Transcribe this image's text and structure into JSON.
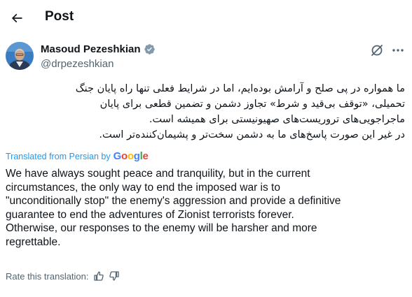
{
  "header": {
    "title": "Post"
  },
  "author": {
    "name": "Masoud Pezeshkian",
    "handle": "@drpezeshkian"
  },
  "post": {
    "original_lines": [
      "ما همواره در پی صلح و آرامش بوده‌ایم، اما در شرایط فعلی تنها راه پایان جنگ",
      "تحمیلی، «توقف بی‌قید و شرط» تجاوز دشمن و تضمین قطعی برای پایان",
      "ماجراجویی‌های تروریست‌های صهیونیستی برای همیشه است.",
      "در غیر این صورت پاسخ‌های ما به دشمن سخت‌تر و پشیمان‌کننده‌تر است."
    ],
    "translated_from": "Translated from Persian by",
    "translation_provider": "Google",
    "translation_lines": [
      "We have always sought peace and tranquility, but in the current",
      "circumstances, the only way to end the imposed war is to",
      "\"unconditionally stop\" the enemy's aggression and provide a definitive",
      "guarantee to end the adventures of Zionist terrorists forever.",
      "Otherwise, our responses to the enemy will be harsher and more",
      "regrettable."
    ],
    "rate_label": "Rate this translation:"
  },
  "colors": {
    "accent": "#1d9bf0",
    "text": "#0f1419",
    "secondary": "#536471"
  },
  "icons": [
    "back-arrow-icon",
    "verified-badge-icon",
    "grok-icon",
    "more-icon",
    "thumbs-up-icon",
    "thumbs-down-icon"
  ]
}
